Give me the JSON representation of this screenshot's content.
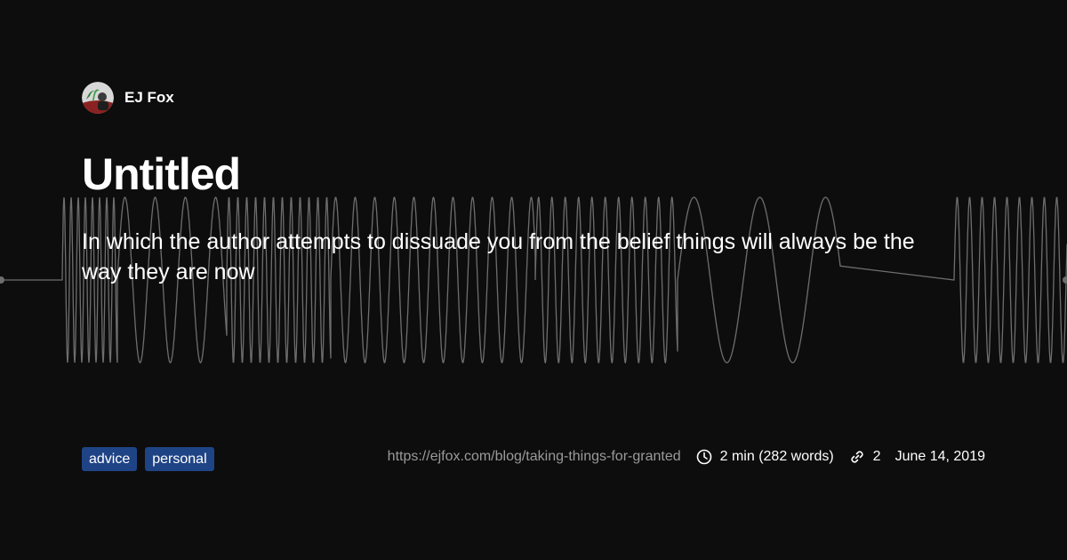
{
  "author": {
    "name": "EJ Fox"
  },
  "post": {
    "title": "Untitled",
    "description": "In which the author attempts to dissuade you from the belief things will always be the way they are now",
    "tags": [
      "advice",
      "personal"
    ],
    "url": "https://ejfox.com/blog/taking-things-for-granted",
    "reading_time": "2 min (282 words)",
    "link_count": "2",
    "date": "June 14, 2019"
  },
  "icons": {
    "avatar": "avatar-image",
    "reading_time": "clock-icon",
    "links": "link-icon"
  },
  "colors": {
    "background": "#0d0d0d",
    "text": "#ffffff",
    "muted_text": "#9a9a9a",
    "tag_background": "#1f4486",
    "waveform": "#6e6e6e"
  }
}
